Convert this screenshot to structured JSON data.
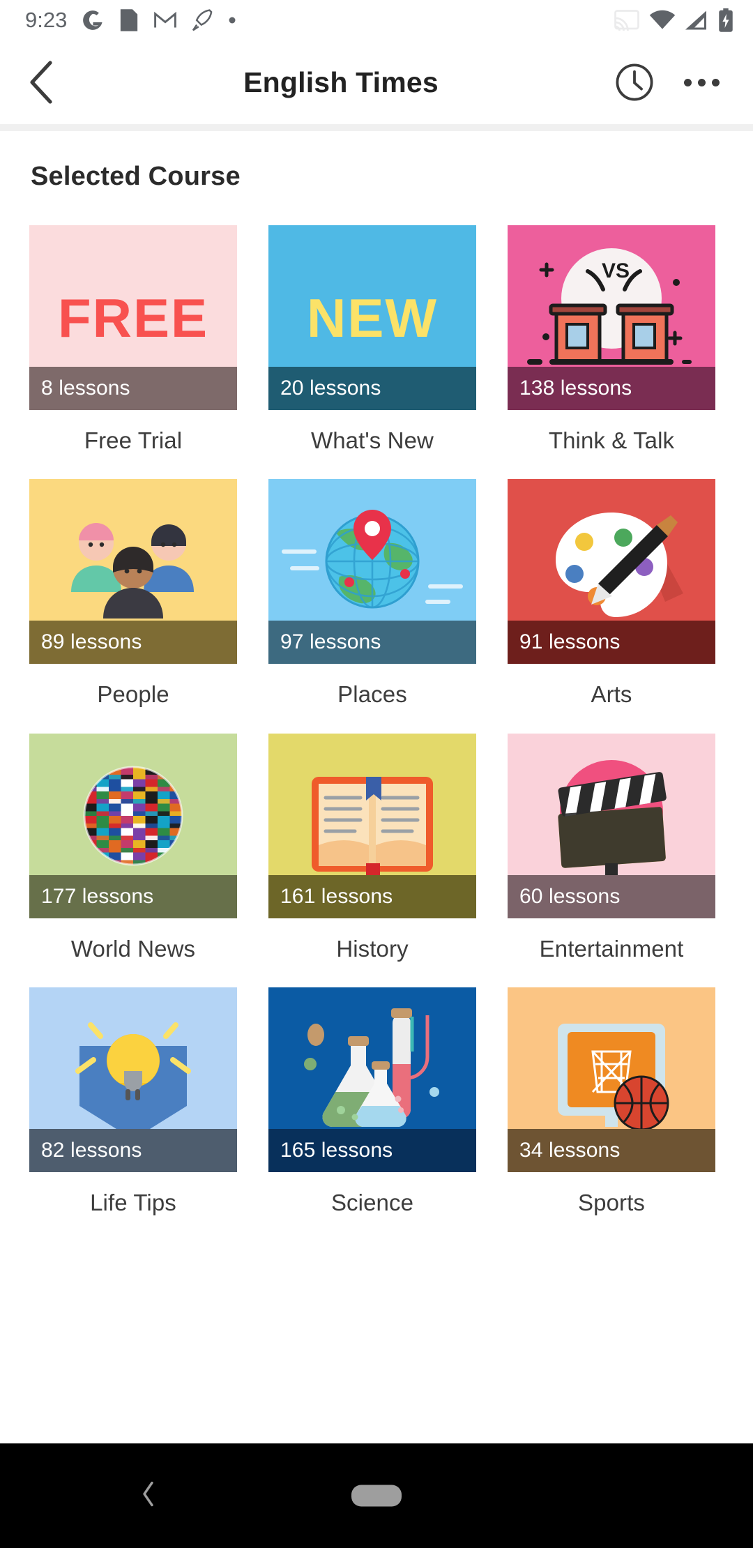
{
  "status_bar": {
    "time": "9:23",
    "left_icons": [
      "google-g-icon",
      "folder-icon",
      "gmail-icon",
      "rocket-icon",
      "dot-icon"
    ],
    "right_icons": [
      "cast-icon",
      "wifi-icon",
      "cellular-signal-icon",
      "battery-charging-icon"
    ]
  },
  "app_bar": {
    "back_label": "‹",
    "title": "English Times",
    "history_icon": "clock-icon",
    "overflow_icon": "more-options-icon"
  },
  "main": {
    "section_title": "Selected Course",
    "courses": [
      {
        "title": "Free Trial",
        "lessons": "8 lessons",
        "art": "free-badge",
        "bg": "#fbdcdd",
        "bar": "#7e6a6a"
      },
      {
        "title": "What's New",
        "lessons": "20 lessons",
        "art": "new-badge",
        "bg": "#4fb9e5",
        "bar": "#1f5c72"
      },
      {
        "title": "Think & Talk",
        "lessons": "138 lessons",
        "art": "debate-podium",
        "bg": "#ed5f9c",
        "bar": "#7a2d52"
      },
      {
        "title": "People",
        "lessons": "89 lessons",
        "art": "people-group",
        "bg": "#fbd97f",
        "bar": "#7e6c34"
      },
      {
        "title": "Places",
        "lessons": "97 lessons",
        "art": "globe-pin",
        "bg": "#7fcdf5",
        "bar": "#3d6a80"
      },
      {
        "title": "Arts",
        "lessons": "91 lessons",
        "art": "paint-palette",
        "bg": "#e0504a",
        "bar": "#6e1f1c"
      },
      {
        "title": "World News",
        "lessons": "177 lessons",
        "art": "flag-globe",
        "bg": "#c6dc9b",
        "bar": "#67704a"
      },
      {
        "title": "History",
        "lessons": "161 lessons",
        "art": "open-book",
        "bg": "#e3d96a",
        "bar": "#6d6628"
      },
      {
        "title": "Entertainment",
        "lessons": "60 lessons",
        "art": "clapperboard",
        "bg": "#fad2da",
        "bar": "#7b6369"
      },
      {
        "title": "Life Tips",
        "lessons": "82 lessons",
        "art": "idea-bulb",
        "bg": "#b4d4f5",
        "bar": "#4e5d6e"
      },
      {
        "title": "Science",
        "lessons": "165 lessons",
        "art": "lab-flasks",
        "bg": "#0b5ba4",
        "bar": "#08305b"
      },
      {
        "title": "Sports",
        "lessons": "34 lessons",
        "art": "basketball",
        "bg": "#fbc584",
        "bar": "#6e5433"
      }
    ]
  },
  "nav_bar": {
    "back_icon": "nav-back-icon",
    "home_pill": "nav-home-pill"
  }
}
